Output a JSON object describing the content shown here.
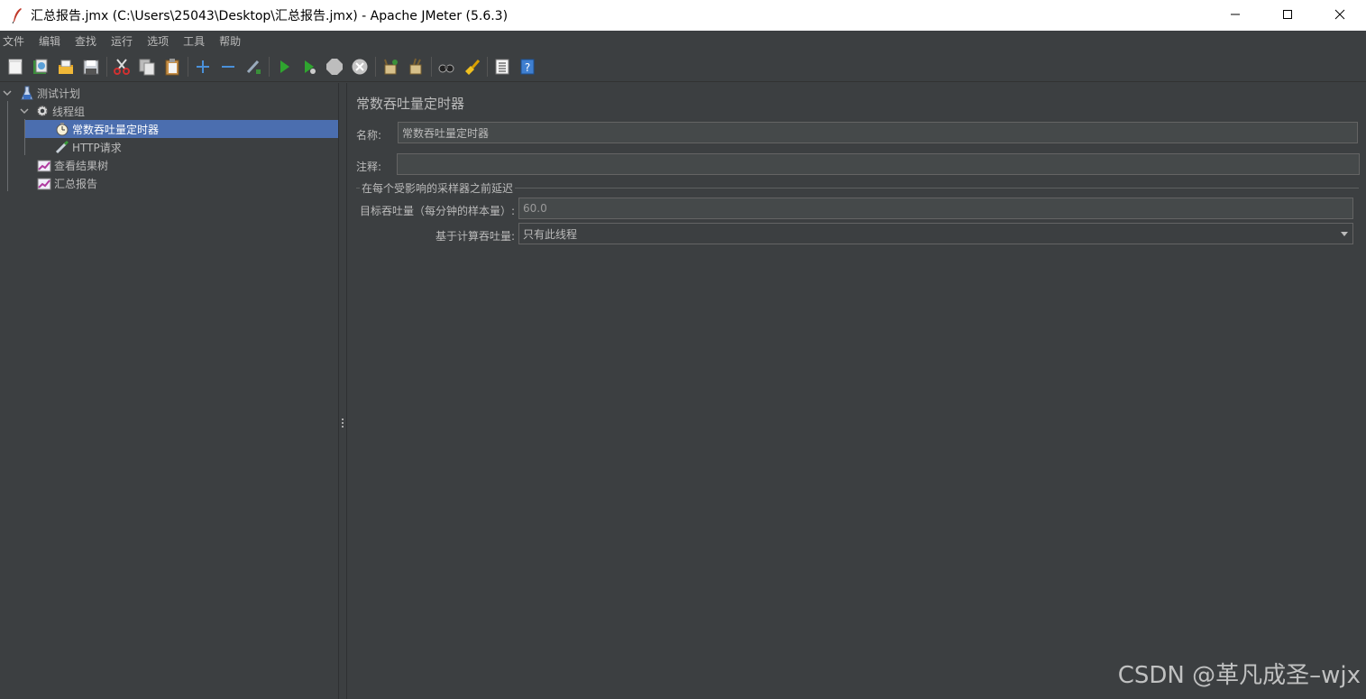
{
  "window": {
    "title": "汇总报告.jmx (C:\\Users\\25043\\Desktop\\汇总报告.jmx) - Apache JMeter (5.6.3)"
  },
  "menu": [
    "文件",
    "编辑",
    "查找",
    "运行",
    "选项",
    "工具",
    "帮助"
  ],
  "toolbar": {
    "icons": [
      "new-icon",
      "templates-icon",
      "open-icon",
      "save-icon",
      "cut-icon",
      "copy-icon",
      "paste-icon",
      "expand-icon",
      "collapse-icon",
      "toggle-icon",
      "start-icon",
      "start-no-pause-icon",
      "stop-icon",
      "shutdown-icon",
      "clear-icon",
      "clear-all-icon",
      "search-icon",
      "reset-search-icon",
      "function-helper-icon",
      "help-icon"
    ]
  },
  "tree": {
    "items": [
      {
        "label": "测试计划"
      },
      {
        "label": "线程组"
      },
      {
        "label": "常数吞吐量定时器"
      },
      {
        "label": "HTTP请求"
      },
      {
        "label": "查看结果树"
      },
      {
        "label": "汇总报告"
      }
    ]
  },
  "panel": {
    "title": "常数吞吐量定时器",
    "name_label": "名称:",
    "name_value": "常数吞吐量定时器",
    "comment_label": "注释:",
    "comment_value": "",
    "group_title": "在每个受影响的采样器之前延迟",
    "target_label": "目标吞吐量（每分钟的样本量）:",
    "target_value": "60.0",
    "calc_label": "基于计算吞吐量:",
    "calc_value": "只有此线程"
  },
  "watermark": "CSDN @革凡成圣–wjx"
}
